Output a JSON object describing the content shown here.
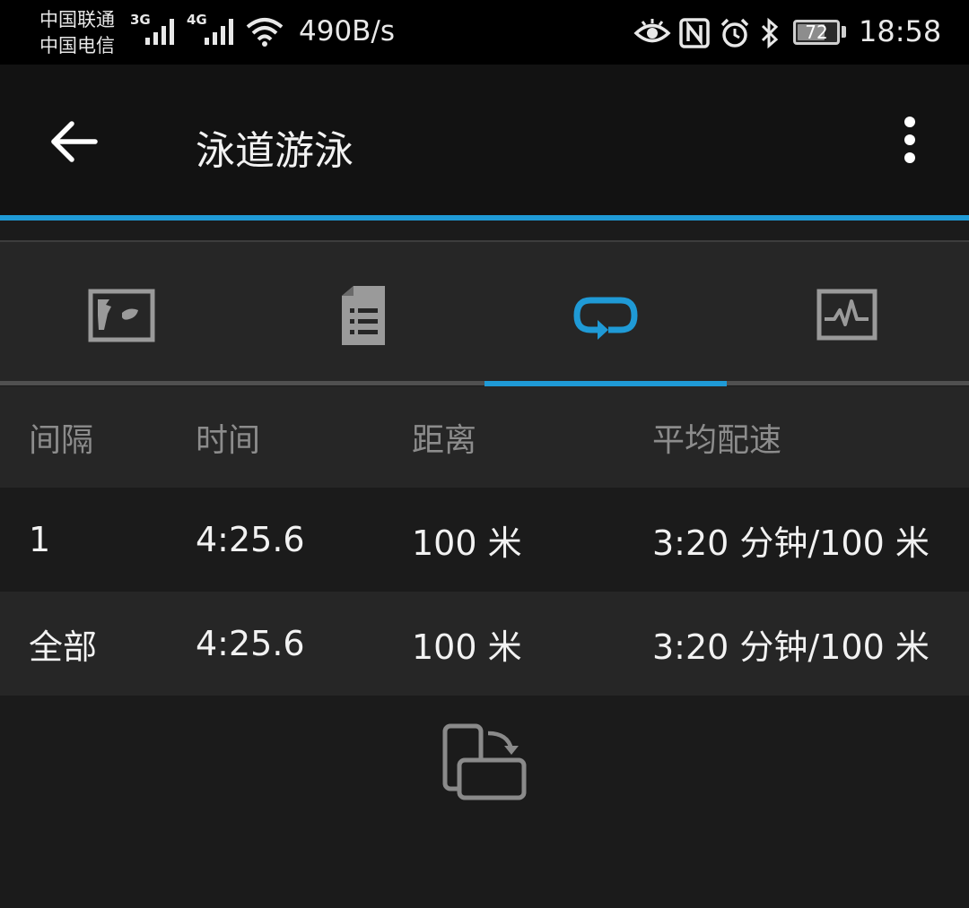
{
  "status_bar": {
    "carrier_1": "中国联通",
    "carrier_2": "中国电信",
    "network_1": "3G",
    "network_2": "4G",
    "net_speed": "490B/s",
    "battery_level": "72",
    "time": "18:58"
  },
  "app_bar": {
    "title": "泳道游泳"
  },
  "tabs": [
    {
      "icon": "map-icon",
      "active": false
    },
    {
      "icon": "details-list-icon",
      "active": false
    },
    {
      "icon": "laps-loop-icon",
      "active": true
    },
    {
      "icon": "chart-icon",
      "active": false
    }
  ],
  "table": {
    "headers": [
      "间隔",
      "时间",
      "距离",
      "平均配速"
    ],
    "rows": [
      [
        "1",
        "4:25.6",
        "100 米",
        "3:20 分钟/100 米"
      ],
      [
        "全部",
        "4:25.6",
        "100 米",
        "3:20 分钟/100 米"
      ]
    ]
  },
  "colors": {
    "accent": "#1f9ad6",
    "background": "#1b1b1b",
    "header_background": "#262626"
  }
}
